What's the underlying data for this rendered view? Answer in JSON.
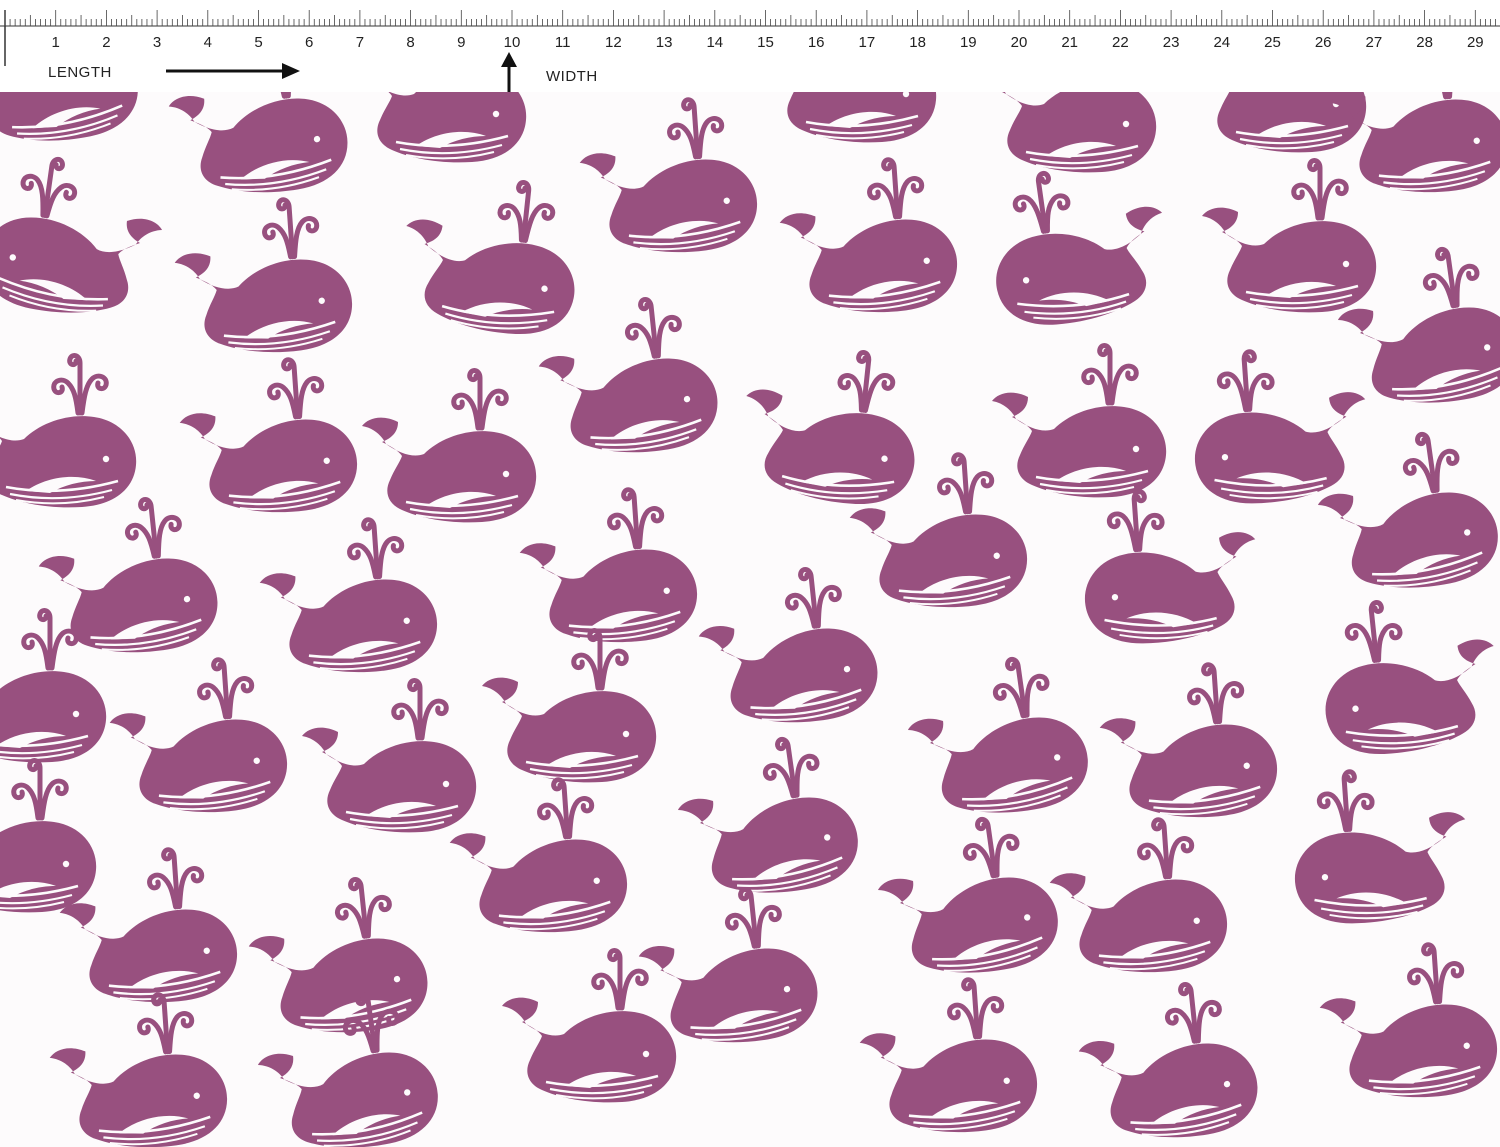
{
  "ruler": {
    "numbers": [
      "1",
      "2",
      "3",
      "4",
      "5",
      "6",
      "7",
      "8",
      "9",
      "10",
      "11",
      "12",
      "13",
      "14",
      "15",
      "16",
      "17",
      "18",
      "19",
      "20",
      "21",
      "22",
      "23",
      "24",
      "25",
      "26",
      "27",
      "28",
      "29"
    ],
    "length_label": "LENGTH",
    "width_label": "WIDTH"
  },
  "fabric": {
    "motif": "whale-icon",
    "motif_color": "#98507f",
    "background_color": "#fdfbfc"
  }
}
